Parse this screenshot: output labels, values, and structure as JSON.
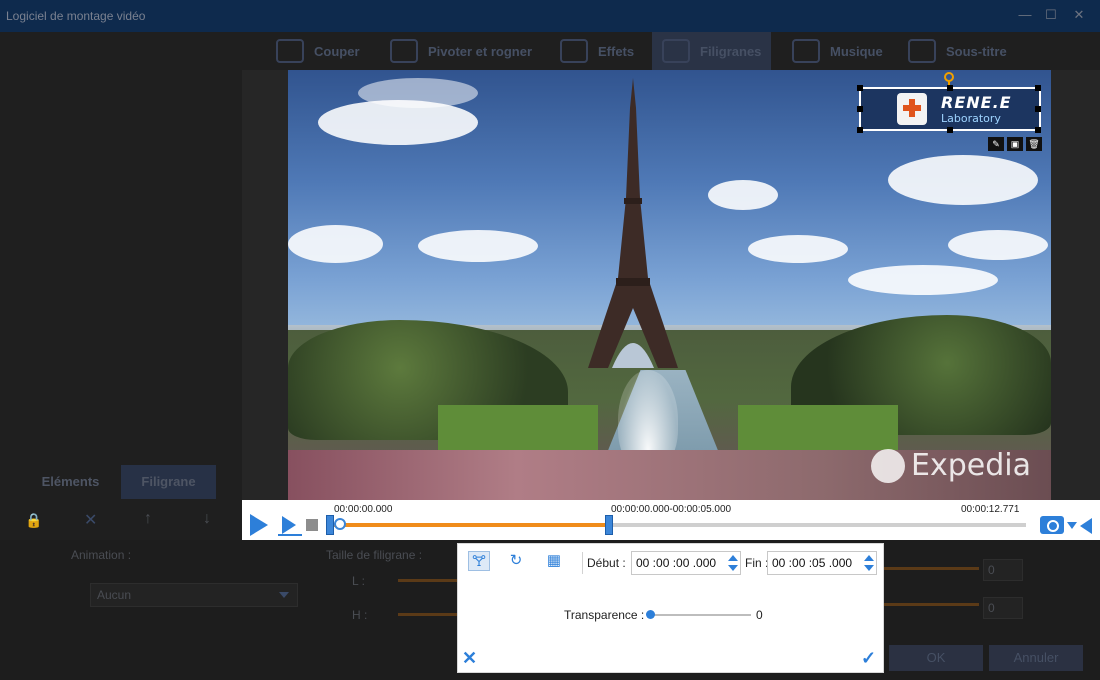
{
  "window": {
    "title": "Logiciel de montage vidéo",
    "controls": [
      "—",
      "☐",
      "✕"
    ]
  },
  "toolbar": {
    "tabs": [
      {
        "label": "Couper",
        "icon": "scissors-icon"
      },
      {
        "label": "Pivoter et rogner",
        "icon": "crop-icon"
      },
      {
        "label": "Effets",
        "icon": "effects-icon"
      },
      {
        "label": "Filigranes",
        "icon": "watermark-icon",
        "active": true
      },
      {
        "label": "Musique",
        "icon": "music-icon"
      },
      {
        "label": "Sous-titre",
        "icon": "subtitle-icon"
      }
    ]
  },
  "left_panel": {
    "tabs": [
      "Eléments",
      "Filigrane"
    ],
    "animation_label": "Animation :",
    "animation_value": "Aucun",
    "size_label": "Taille de filigrane :",
    "l_label": "L :",
    "h_label": "H :",
    "l_value": "0",
    "h_value": "0",
    "ok_label": "OK",
    "cancel_label": "Annuler"
  },
  "watermark": {
    "name": "RENE.E",
    "sub": "Laboratory"
  },
  "video_overlay": {
    "brand": "Expedia"
  },
  "timeline": {
    "start": "00:00:00.000",
    "range": "00:00:00.000-00:00:05.000",
    "end": "00:00:12.771"
  },
  "popup": {
    "debut_label": "Début :",
    "debut_value": "00 :00 :00 .000",
    "fin_label": "Fin :",
    "fin_value": "00 :00 :05 .000",
    "transparence_label": "Transparence :",
    "transparence_value": "0"
  },
  "colors": {
    "accent": "#2d7fd9",
    "progress": "#f08c1a"
  }
}
